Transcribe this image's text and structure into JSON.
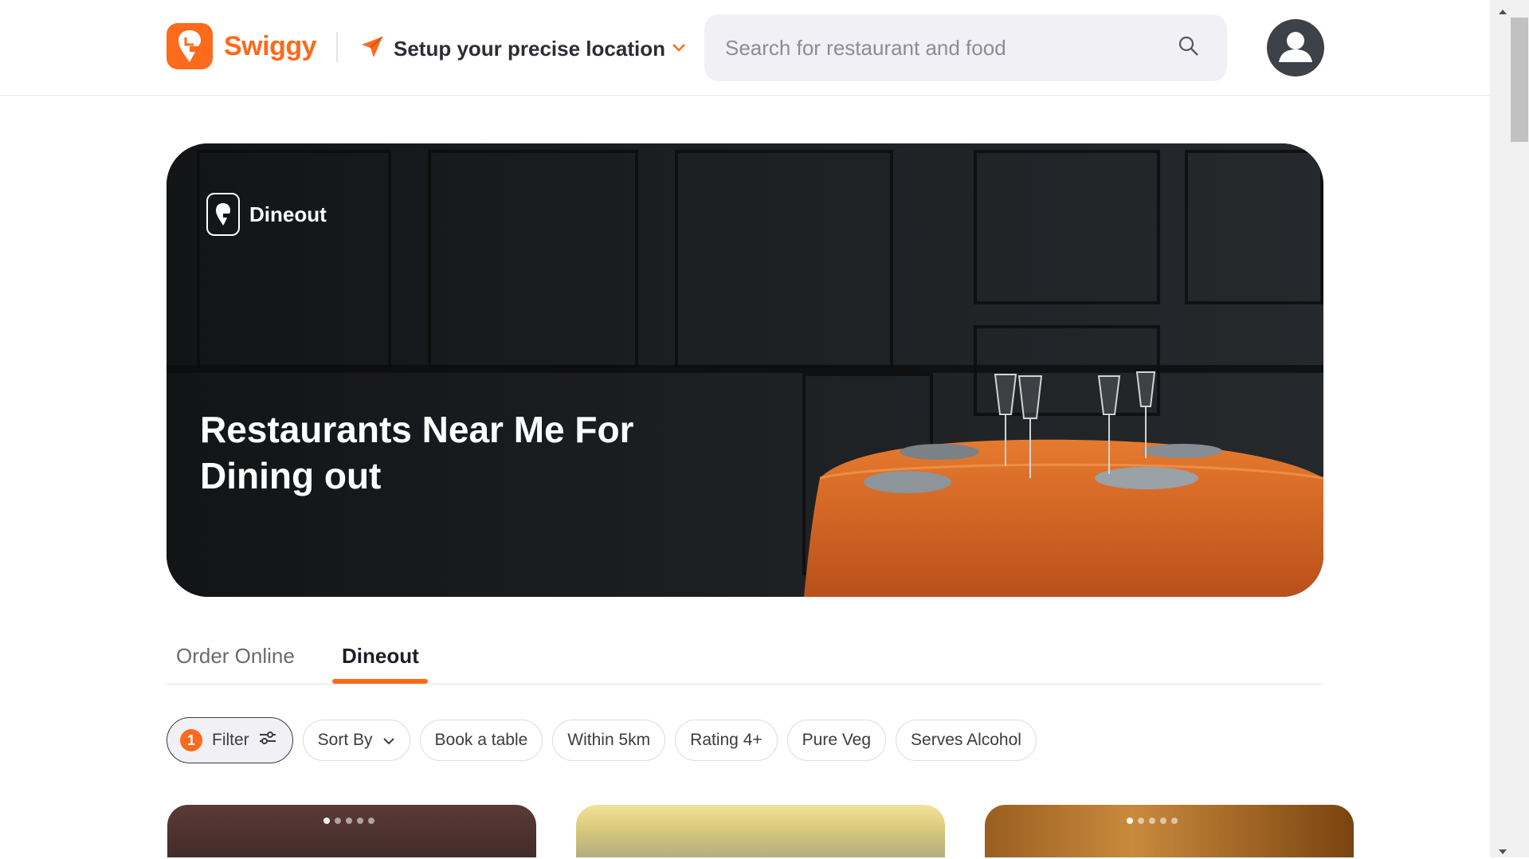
{
  "header": {
    "brand": "Swiggy",
    "location_label": "Setup your precise location",
    "search_placeholder": "Search for restaurant and food"
  },
  "hero": {
    "brand_label": "Dineout",
    "title": "Restaurants Near Me For Dining out"
  },
  "tabs": [
    {
      "label": "Order Online",
      "active": false
    },
    {
      "label": "Dineout",
      "active": true
    }
  ],
  "filters": {
    "filter_label": "Filter",
    "filter_count": "1",
    "sort_label": "Sort By",
    "chips": [
      "Book a table",
      "Within 5km",
      "Rating 4+",
      "Pure Veg",
      "Serves Alcohol"
    ]
  },
  "colors": {
    "brand_orange": "#fc6a1b",
    "text_dark": "#1b1e24"
  }
}
